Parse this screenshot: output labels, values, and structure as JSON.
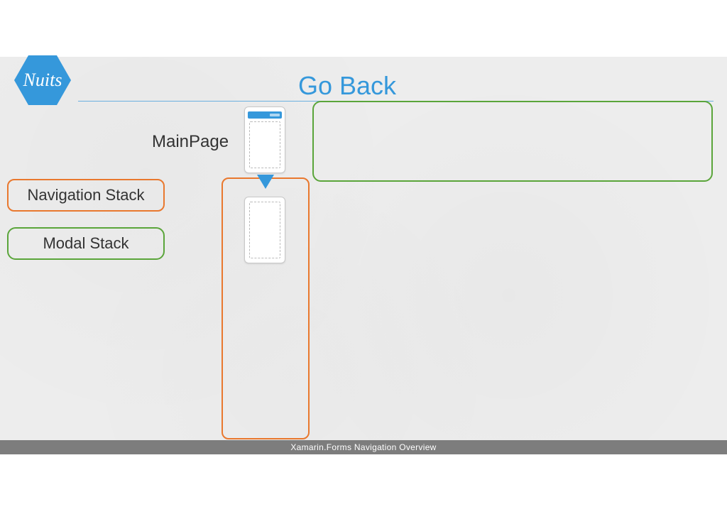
{
  "logo": {
    "text": "Nuits"
  },
  "title": "Go Back",
  "labels": {
    "main_page": "MainPage",
    "navigation_stack": "Navigation Stack",
    "modal_stack": "Modal Stack"
  },
  "footer": "Xamarin.Forms Navigation Overview",
  "colors": {
    "accent": "#3598db",
    "orange": "#e9782e",
    "green": "#5aa53a"
  }
}
